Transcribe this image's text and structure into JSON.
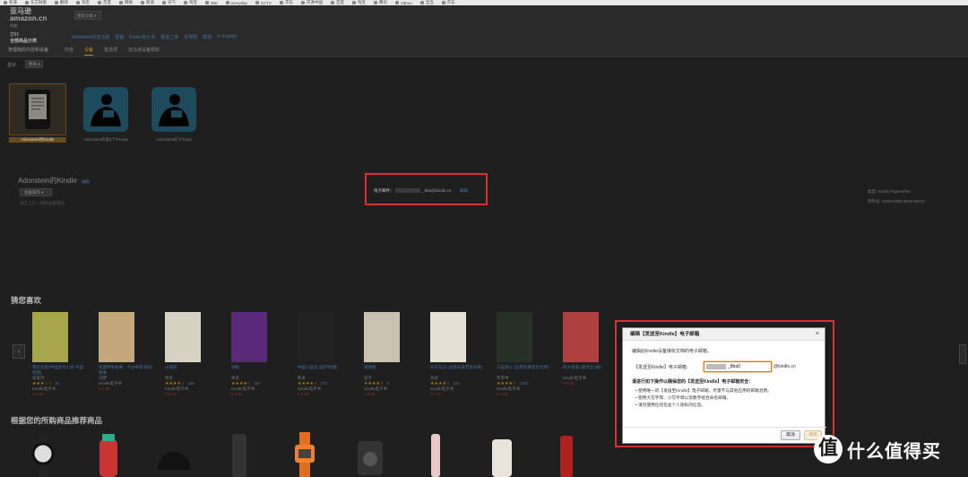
{
  "bookmarks": [
    "有道",
    "东方财富",
    "翻译",
    "淘宝",
    "百度",
    "网易",
    "新浪",
    "天气",
    "淘宝",
    "360",
    "everyday",
    "CCTV",
    "京东",
    "开源中国",
    "百度",
    "淘宝",
    "腾讯",
    "Yahoo",
    "当当",
    "京东"
  ],
  "header": {
    "logo_text": "amazon.cn",
    "logo_cn": "亚马逊",
    "logo_sub": "卓越",
    "search_category": "搜索分类",
    "hello": "您好",
    "all_categories": "全部商品分类",
    "nav": [
      "Adonstein的亚马逊",
      "促销",
      "Kindle电子书",
      "惠选之家",
      "全球购",
      "帮助",
      "In English"
    ],
    "manage_label": "管理我的内容和设备",
    "tabs": [
      {
        "label": "内容",
        "active": false
      },
      {
        "label": "设备",
        "active": true
      },
      {
        "label": "首选项",
        "active": false
      },
      {
        "label": "亚马逊设备帮助",
        "active": false
      }
    ]
  },
  "filter": {
    "label": "显示",
    "button": "所有"
  },
  "devices": [
    {
      "caption": "Adonstein的Kindle",
      "selected": true,
      "type": "kindle"
    },
    {
      "caption": "Adonstein的第2个iPhone",
      "selected": false,
      "type": "reader"
    },
    {
      "caption": "Adonstein的 iPhone",
      "selected": false,
      "type": "reader"
    }
  ],
  "detail": {
    "name": "Adonstein的Kindle",
    "edit": "编辑",
    "actions_button": "设备操作",
    "hint": "请在上方一选择设备操作。",
    "email_label": "电子邮件：",
    "email_value": "_8ba@kindle.cn",
    "email_edit": "编辑",
    "type_label": "类型: Kindle Paperwhite",
    "serial_label": "序列号: G000 K803 8026 N8YQ"
  },
  "recommend": {
    "title": "猜您喜欢",
    "books": [
      {
        "title": "我的读者(中国近代小说·中国经典)",
        "author": "张爱玲",
        "stars": "★★★☆☆",
        "count": "22",
        "format": "Kindle电子书",
        "price": "¥ 0.99",
        "color": "#a8a64a"
      },
      {
        "title": "经典传奇故事：今古奇观 民间故事",
        "author": "冯梦",
        "stars": "",
        "count": "",
        "format": "Kindle电子书",
        "price": "¥ 1.99",
        "color": "#c4a77a"
      },
      {
        "title": "山海经",
        "author": "佚名",
        "stars": "★★★★☆",
        "count": "166",
        "format": "Kindle电子书",
        "price": "¥ 0.99",
        "color": "#d8d2c4"
      },
      {
        "title": "诗经",
        "author": "佚名",
        "stars": "★★★★☆",
        "count": "287",
        "format": "Kindle电子书",
        "price": "¥ 0.99",
        "color": "#5a2a78"
      },
      {
        "title": "中国三国志 (国学经典)",
        "author": "陈寿",
        "stars": "★★★★☆",
        "count": "173",
        "format": "Kindle电子书",
        "price": "¥ 0.99",
        "color": "#222"
      },
      {
        "title": "道德经",
        "author": "老子",
        "stars": "★★★★☆",
        "count": "9",
        "format": "Kindle电子书",
        "price": "¥ 0.99",
        "color": "#c9c2b0"
      },
      {
        "title": "孙子兵法 (古典名著普及文库)",
        "author": "孙武",
        "stars": "★★★★☆",
        "count": "334",
        "format": "Kindle电子书",
        "price": "¥ 0.99",
        "color": "#e4e0d4"
      },
      {
        "title": "三国演义 (古典名著普及文库)",
        "author": "罗贯中",
        "stars": "★★★★☆",
        "count": "1387",
        "format": "Kindle电子书",
        "price": "¥ 0.99",
        "color": "#263026"
      },
      {
        "title": "四大名著 (套装全4册)",
        "author": "",
        "stars": "",
        "count": "",
        "format": "Kindle电子书",
        "price": "¥ 0.99",
        "color": "#b04040"
      }
    ]
  },
  "purchase_recommend": {
    "title": "根据您的所购商品推荐商品"
  },
  "dialog": {
    "title": "编辑【发送至Kindle】电子邮箱",
    "close": "×",
    "intro": "编辑此Kindle设备接收文档的电子邮箱。",
    "field_label": "【发送至Kindle】电子邮箱:",
    "field_value": "_8ba0",
    "domain": "@kindle.cn",
    "rules_title": "请进行如下操作以确保您的【发送至Kindle】电子邮箱安全：",
    "rules": [
      "使用唯一的【发送至Kindle】电子邮箱，尽量不与其他应用的邮箱混用。",
      "使用大写字母、小写字母以及数字组合命名邮箱。",
      "请勿使用任何包含个人隐私的信息。"
    ],
    "cancel": "取消",
    "save": "保存"
  },
  "watermark": {
    "circle": "值",
    "text": "什么值得买"
  }
}
